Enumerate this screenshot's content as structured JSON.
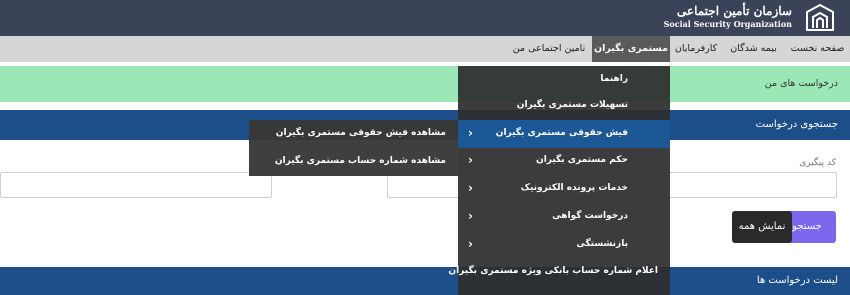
{
  "header": {
    "org_name_fa": "سازمان تأمین اجتماعی",
    "org_name_en": "Social Security Organization"
  },
  "nav": {
    "home": "صفحه نخست",
    "insured": "بیمه شدگان",
    "employers": "کارفرمایان",
    "pensioners": "مستمری بگیران",
    "my_social_security": "تامین اجتماعی من"
  },
  "sections": {
    "my_requests": "درخواست های من",
    "search_request": "جستجوی درخواست",
    "request_list": "لیست درخواست ها"
  },
  "form": {
    "tracking_code_label": "کد پیگیری",
    "search_button": "جستجو",
    "show_all_button": "نمایش همه"
  },
  "menu": {
    "items": [
      {
        "label": "راهنما",
        "has_submenu": false
      },
      {
        "label": "تسهیلات مستمری بگیران",
        "has_submenu": false
      },
      {
        "label": "فیش حقوقی مستمری بگیران",
        "has_submenu": true,
        "active": true
      },
      {
        "label": "حکم مستمری بگیران",
        "has_submenu": true
      },
      {
        "label": "خدمات پرونده الکترونیک",
        "has_submenu": true
      },
      {
        "label": "درخواست گواهی",
        "has_submenu": true
      },
      {
        "label": "بازنشستگی",
        "has_submenu": true
      },
      {
        "label": "اعلام شماره حساب بانکی ویژه مستمری بگیران",
        "has_submenu": false
      }
    ],
    "chevron_glyph": "›"
  },
  "submenu": {
    "items": [
      {
        "label": "مشاهده فیش حقوقی مستمری بگیران"
      },
      {
        "label": "مشاهده شماره حساب مستمری بگیران"
      }
    ]
  },
  "colors": {
    "header_bg": "#3a4358",
    "nav_bg": "#d6d6d6",
    "nav_active": "#5a5a5a",
    "success_bar": "#9be7b5",
    "section_bar": "#1c4f8a",
    "menu_bg": "#2d2d2d",
    "menu_active": "#1c5895",
    "search_button": "#7b67ee",
    "show_all_button": "#2a2a2a"
  }
}
